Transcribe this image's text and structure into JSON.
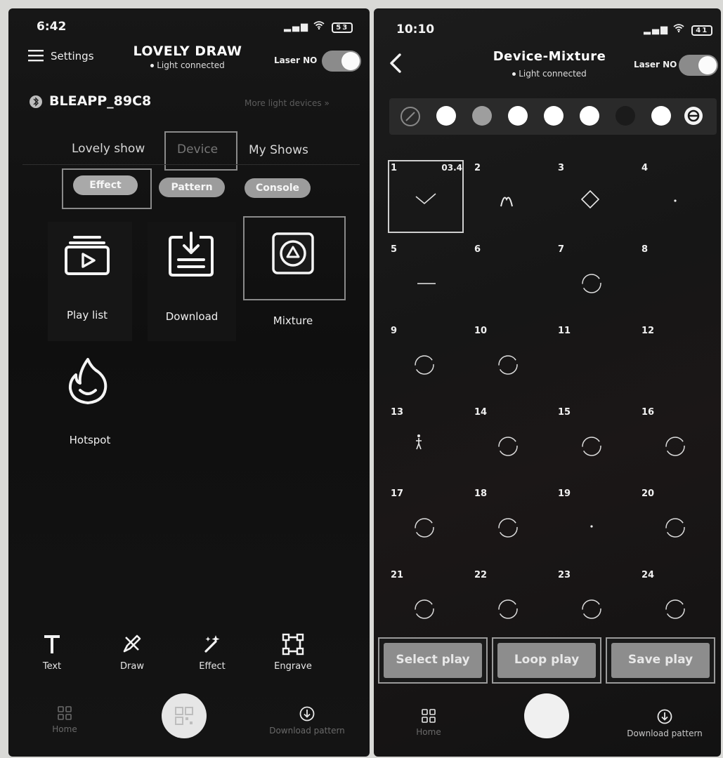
{
  "left": {
    "status": {
      "time": "6:42",
      "signal": "▂▄▆",
      "battery": "53"
    },
    "header": {
      "settings_label": "Settings",
      "title": "LOVELY DRAW",
      "subtitle": "Light connected",
      "laser_label": "Laser NO"
    },
    "device": {
      "name": "BLEAPP_89C8",
      "more_label": "More light devices"
    },
    "tabs": [
      "Lovely show",
      "Device",
      "My Shows"
    ],
    "sub_tabs": [
      "Effect",
      "Pattern",
      "Console"
    ],
    "tiles": [
      {
        "label": "Play list",
        "icon": "playlist-icon"
      },
      {
        "label": "Download",
        "icon": "download-icon"
      },
      {
        "label": "Mixture",
        "icon": "mixture-icon"
      },
      {
        "label": "Hotspot",
        "icon": "flame-icon"
      }
    ],
    "tools": [
      {
        "label": "Text",
        "icon": "text-icon"
      },
      {
        "label": "Draw",
        "icon": "draw-icon"
      },
      {
        "label": "Effect",
        "icon": "magic-wand-icon"
      },
      {
        "label": "Engrave",
        "icon": "engrave-icon"
      }
    ],
    "nav": {
      "home": "Home",
      "download": "Download pattern"
    }
  },
  "right": {
    "status": {
      "time": "10:10",
      "signal": "▂▄▆",
      "battery": "41"
    },
    "header": {
      "title": "Device-Mixture",
      "subtitle": "Light connected",
      "laser_label": "Laser NO"
    },
    "colors": [
      "none",
      "#ffffff",
      "#9e9e9e",
      "#ffffff",
      "#ffffff",
      "#ffffff",
      "#1b1b1b",
      "#ffffff"
    ],
    "cells": [
      {
        "n": "1",
        "time": "03.4",
        "shape": "check"
      },
      {
        "n": "2",
        "shape": "m"
      },
      {
        "n": "3",
        "shape": "diamond"
      },
      {
        "n": "4",
        "shape": "dot"
      },
      {
        "n": "5",
        "shape": "line"
      },
      {
        "n": "6",
        "shape": "none"
      },
      {
        "n": "7",
        "shape": "circle"
      },
      {
        "n": "8",
        "shape": "none"
      },
      {
        "n": "9",
        "shape": "circle"
      },
      {
        "n": "10",
        "shape": "circle"
      },
      {
        "n": "11",
        "shape": "none"
      },
      {
        "n": "12",
        "shape": "none"
      },
      {
        "n": "13",
        "shape": "figure"
      },
      {
        "n": "14",
        "shape": "circle"
      },
      {
        "n": "15",
        "shape": "circle"
      },
      {
        "n": "16",
        "shape": "circle"
      },
      {
        "n": "17",
        "shape": "circle"
      },
      {
        "n": "18",
        "shape": "circle"
      },
      {
        "n": "19",
        "shape": "dot"
      },
      {
        "n": "20",
        "shape": "circle"
      },
      {
        "n": "21",
        "shape": "circle"
      },
      {
        "n": "22",
        "shape": "circle"
      },
      {
        "n": "23",
        "shape": "circle"
      },
      {
        "n": "24",
        "shape": "circle"
      }
    ],
    "actions": [
      "Select play",
      "Loop play",
      "Save play"
    ],
    "nav": {
      "home": "Home",
      "download": "Download pattern"
    }
  }
}
